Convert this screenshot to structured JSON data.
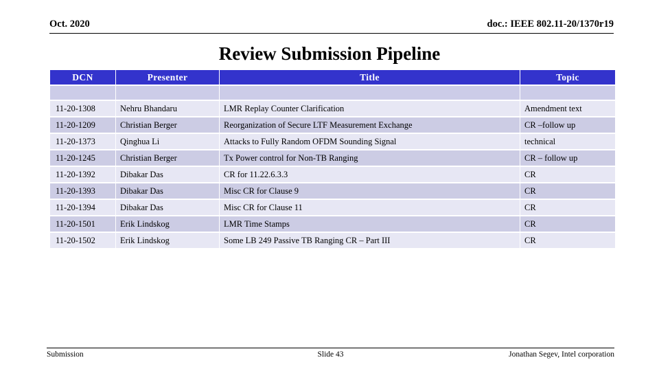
{
  "header": {
    "date": "Oct. 2020",
    "doc_reference": "doc.: IEEE 802.11-20/1370r19"
  },
  "title": "Review Submission Pipeline",
  "table": {
    "columns": [
      "DCN",
      "Presenter",
      "Title",
      "Topic"
    ],
    "header_background": "#3333CC",
    "header_text_color": "#FFFFFF",
    "row_color_light": "#E7E7F4",
    "row_color_dark": "#CCCCE4",
    "spacer_row_color": "#CCCCE8",
    "rows": [
      {
        "dcn": "11-20-1308",
        "presenter": "Nehru Bhandaru",
        "title": "LMR Replay Counter Clarification",
        "topic": "Amendment text"
      },
      {
        "dcn": "11-20-1209",
        "presenter": "Christian Berger",
        "title": "Reorganization of Secure LTF Measurement Exchange",
        "topic": "CR –follow up"
      },
      {
        "dcn": "11-20-1373",
        "presenter": "Qinghua Li",
        "title": "Attacks to Fully Random OFDM Sounding Signal",
        "topic": "technical"
      },
      {
        "dcn": "11-20-1245",
        "presenter": "Christian Berger",
        "title": "Tx Power control for Non-TB Ranging",
        "topic": "CR – follow up"
      },
      {
        "dcn": "11-20-1392",
        "presenter": "Dibakar Das",
        "title": "CR for 11.22.6.3.3",
        "topic": "CR"
      },
      {
        "dcn": "11-20-1393",
        "presenter": "Dibakar Das",
        "title": "Misc CR for Clause 9",
        "topic": "CR"
      },
      {
        "dcn": "11-20-1394",
        "presenter": "Dibakar Das",
        "title": "Misc CR for Clause 11",
        "topic": "CR"
      },
      {
        "dcn": "11-20-1501",
        "presenter": "Erik Lindskog",
        "title": "LMR Time Stamps",
        "topic": "CR"
      },
      {
        "dcn": "11-20-1502",
        "presenter": "Erik Lindskog",
        "title": "Some LB 249 Passive TB Ranging CR – Part III",
        "topic": "CR"
      }
    ]
  },
  "footer": {
    "left": "Submission",
    "center": "Slide 43",
    "right": "Jonathan Segev, Intel corporation"
  }
}
